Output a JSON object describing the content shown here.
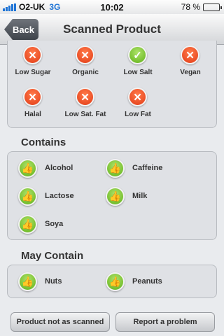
{
  "status_bar": {
    "carrier": "O2-UK",
    "network": "3G",
    "time": "10:02",
    "battery_text": "78 %",
    "battery_level": 0.78
  },
  "nav": {
    "back_label": "Back",
    "title": "Scanned Product"
  },
  "dietary": [
    {
      "label": "Low Sugar",
      "status": "no",
      "icon": "cross-icon"
    },
    {
      "label": "Organic",
      "status": "no",
      "icon": "cross-icon"
    },
    {
      "label": "Low Salt",
      "status": "yes",
      "icon": "check-icon"
    },
    {
      "label": "Vegan",
      "status": "no",
      "icon": "cross-icon"
    },
    {
      "label": "Halal",
      "status": "no",
      "icon": "cross-icon"
    },
    {
      "label": "Low Sat. Fat",
      "status": "no",
      "icon": "cross-icon"
    },
    {
      "label": "Low Fat",
      "status": "no",
      "icon": "cross-icon"
    }
  ],
  "contains": {
    "title": "Contains",
    "items": [
      "Alcohol",
      "Caffeine",
      "Lactose",
      "Milk",
      "Soya"
    ]
  },
  "may_contain": {
    "title": "May Contain",
    "items": [
      "Nuts",
      "Peanuts"
    ]
  },
  "footer": {
    "not_as_scanned_label": "Product not as scanned",
    "report_label": "Report a problem"
  },
  "colors": {
    "cross_badge": "#e23b16",
    "check_badge": "#5fb018",
    "network_blue": "#1f74d6"
  }
}
